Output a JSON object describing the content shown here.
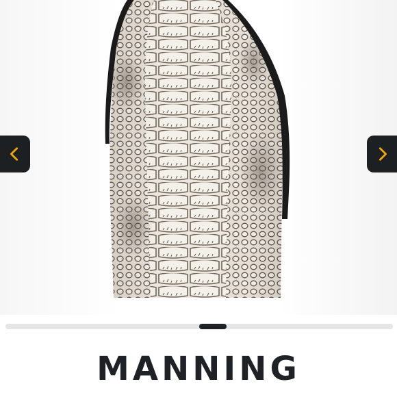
{
  "product": {
    "title": "MANNING"
  },
  "gallery": {
    "image_subject": "python-snakeskin-boot-shaft",
    "prev_icon": "chevron-left-icon",
    "next_icon": "chevron-right-icon",
    "scroll_position": 0.5
  },
  "colors": {
    "accent": "#f2a900",
    "nav_bg": "#1c2023",
    "text": "#1e2226",
    "track": "#e5e5e5"
  }
}
